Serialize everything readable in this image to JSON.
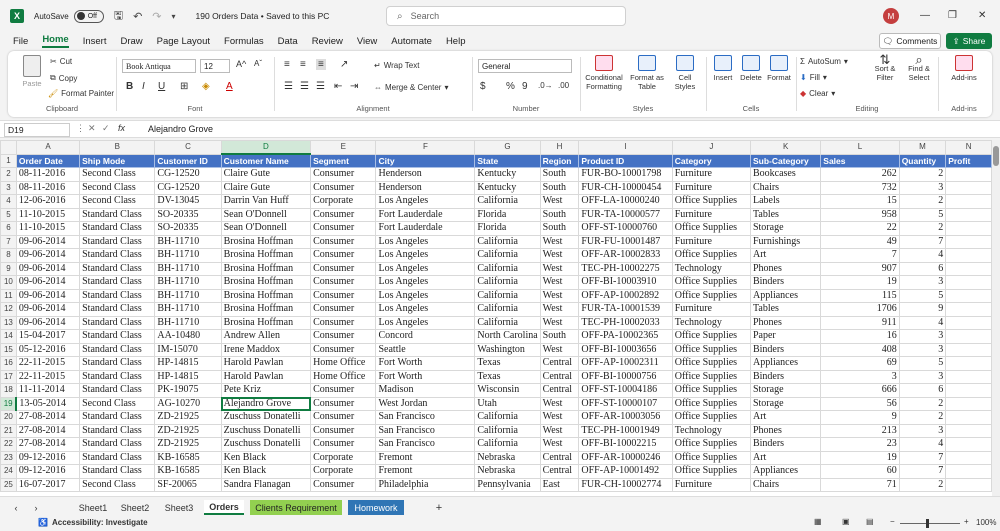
{
  "titlebar": {
    "app_icon": "X",
    "autosave_label": "AutoSave",
    "autosave_state": "Off",
    "doc_title": "190 Orders Data • Saved to this PC",
    "search_placeholder": "Search",
    "user_initial": "M"
  },
  "menu": {
    "items": [
      "File",
      "Home",
      "Insert",
      "Draw",
      "Page Layout",
      "Formulas",
      "Data",
      "Review",
      "View",
      "Automate",
      "Help"
    ],
    "active": "Home",
    "comments": "Comments",
    "share": "Share"
  },
  "ribbon": {
    "clipboard": {
      "title": "Clipboard",
      "paste": "Paste",
      "cut": "Cut",
      "copy": "Copy",
      "format_painter": "Format Painter"
    },
    "font": {
      "title": "Font",
      "name": "Book Antiqua",
      "size": "12",
      "bold": "B",
      "italic": "I",
      "underline": "U"
    },
    "alignment": {
      "title": "Alignment",
      "wrap": "Wrap Text",
      "merge": "Merge & Center"
    },
    "number": {
      "title": "Number",
      "format": "General",
      "currency": "$",
      "percent": "%",
      "comma": "9"
    },
    "styles": {
      "title": "Styles",
      "conditional": "Conditional Formatting",
      "format_table": "Format as Table",
      "cell_styles": "Cell Styles"
    },
    "cells": {
      "title": "Cells",
      "insert": "Insert",
      "delete": "Delete",
      "format": "Format"
    },
    "editing": {
      "title": "Editing",
      "autosum": "AutoSum",
      "fill": "Fill",
      "clear": "Clear",
      "sort": "Sort & Filter",
      "find": "Find & Select"
    },
    "addins": {
      "title": "Add-ins",
      "label": "Add-ins"
    }
  },
  "formula_bar": {
    "name_box": "D19",
    "fx": "fx",
    "value": "Alejandro Grove"
  },
  "sheet": {
    "columns": [
      "A",
      "B",
      "C",
      "D",
      "E",
      "F",
      "G",
      "H",
      "I",
      "J",
      "K",
      "L",
      "M",
      "N"
    ],
    "headers": [
      "Order Date",
      "Ship Mode",
      "Customer ID",
      "Customer Name",
      "Segment",
      "City",
      "State",
      "Region",
      "Product ID",
      "Category",
      "Sub-Category",
      "Sales",
      "Quantity",
      "Profit"
    ],
    "rows": [
      [
        "08-11-2016",
        "Second Class",
        "CG-12520",
        "Claire Gute",
        "Consumer",
        "Henderson",
        "Kentucky",
        "South",
        "FUR-BO-10001798",
        "Furniture",
        "Bookcases",
        "262",
        "2",
        ""
      ],
      [
        "08-11-2016",
        "Second Class",
        "CG-12520",
        "Claire Gute",
        "Consumer",
        "Henderson",
        "Kentucky",
        "South",
        "FUR-CH-10000454",
        "Furniture",
        "Chairs",
        "732",
        "3",
        ""
      ],
      [
        "12-06-2016",
        "Second Class",
        "DV-13045",
        "Darrin Van Huff",
        "Corporate",
        "Los Angeles",
        "California",
        "West",
        "OFF-LA-10000240",
        "Office Supplies",
        "Labels",
        "15",
        "2",
        ""
      ],
      [
        "11-10-2015",
        "Standard Class",
        "SO-20335",
        "Sean O'Donnell",
        "Consumer",
        "Fort Lauderdale",
        "Florida",
        "South",
        "FUR-TA-10000577",
        "Furniture",
        "Tables",
        "958",
        "5",
        ""
      ],
      [
        "11-10-2015",
        "Standard Class",
        "SO-20335",
        "Sean O'Donnell",
        "Consumer",
        "Fort Lauderdale",
        "Florida",
        "South",
        "OFF-ST-10000760",
        "Office Supplies",
        "Storage",
        "22",
        "2",
        ""
      ],
      [
        "09-06-2014",
        "Standard Class",
        "BH-11710",
        "Brosina Hoffman",
        "Consumer",
        "Los Angeles",
        "California",
        "West",
        "FUR-FU-10001487",
        "Furniture",
        "Furnishings",
        "49",
        "7",
        ""
      ],
      [
        "09-06-2014",
        "Standard Class",
        "BH-11710",
        "Brosina Hoffman",
        "Consumer",
        "Los Angeles",
        "California",
        "West",
        "OFF-AR-10002833",
        "Office Supplies",
        "Art",
        "7",
        "4",
        ""
      ],
      [
        "09-06-2014",
        "Standard Class",
        "BH-11710",
        "Brosina Hoffman",
        "Consumer",
        "Los Angeles",
        "California",
        "West",
        "TEC-PH-10002275",
        "Technology",
        "Phones",
        "907",
        "6",
        ""
      ],
      [
        "09-06-2014",
        "Standard Class",
        "BH-11710",
        "Brosina Hoffman",
        "Consumer",
        "Los Angeles",
        "California",
        "West",
        "OFF-BI-10003910",
        "Office Supplies",
        "Binders",
        "19",
        "3",
        ""
      ],
      [
        "09-06-2014",
        "Standard Class",
        "BH-11710",
        "Brosina Hoffman",
        "Consumer",
        "Los Angeles",
        "California",
        "West",
        "OFF-AP-10002892",
        "Office Supplies",
        "Appliances",
        "115",
        "5",
        ""
      ],
      [
        "09-06-2014",
        "Standard Class",
        "BH-11710",
        "Brosina Hoffman",
        "Consumer",
        "Los Angeles",
        "California",
        "West",
        "FUR-TA-10001539",
        "Furniture",
        "Tables",
        "1706",
        "9",
        ""
      ],
      [
        "09-06-2014",
        "Standard Class",
        "BH-11710",
        "Brosina Hoffman",
        "Consumer",
        "Los Angeles",
        "California",
        "West",
        "TEC-PH-10002033",
        "Technology",
        "Phones",
        "911",
        "4",
        ""
      ],
      [
        "15-04-2017",
        "Standard Class",
        "AA-10480",
        "Andrew Allen",
        "Consumer",
        "Concord",
        "North Carolina",
        "South",
        "OFF-PA-10002365",
        "Office Supplies",
        "Paper",
        "16",
        "3",
        ""
      ],
      [
        "05-12-2016",
        "Standard Class",
        "IM-15070",
        "Irene Maddox",
        "Consumer",
        "Seattle",
        "Washington",
        "West",
        "OFF-BI-10003656",
        "Office Supplies",
        "Binders",
        "408",
        "3",
        ""
      ],
      [
        "22-11-2015",
        "Standard Class",
        "HP-14815",
        "Harold Pawlan",
        "Home Office",
        "Fort Worth",
        "Texas",
        "Central",
        "OFF-AP-10002311",
        "Office Supplies",
        "Appliances",
        "69",
        "5",
        ""
      ],
      [
        "22-11-2015",
        "Standard Class",
        "HP-14815",
        "Harold Pawlan",
        "Home Office",
        "Fort Worth",
        "Texas",
        "Central",
        "OFF-BI-10000756",
        "Office Supplies",
        "Binders",
        "3",
        "3",
        ""
      ],
      [
        "11-11-2014",
        "Standard Class",
        "PK-19075",
        "Pete Kriz",
        "Consumer",
        "Madison",
        "Wisconsin",
        "Central",
        "OFF-ST-10004186",
        "Office Supplies",
        "Storage",
        "666",
        "6",
        ""
      ],
      [
        "13-05-2014",
        "Second Class",
        "AG-10270",
        "Alejandro Grove",
        "Consumer",
        "West Jordan",
        "Utah",
        "West",
        "OFF-ST-10000107",
        "Office Supplies",
        "Storage",
        "56",
        "2",
        ""
      ],
      [
        "27-08-2014",
        "Standard Class",
        "ZD-21925",
        "Zuschuss Donatelli",
        "Consumer",
        "San Francisco",
        "California",
        "West",
        "OFF-AR-10003056",
        "Office Supplies",
        "Art",
        "9",
        "2",
        ""
      ],
      [
        "27-08-2014",
        "Standard Class",
        "ZD-21925",
        "Zuschuss Donatelli",
        "Consumer",
        "San Francisco",
        "California",
        "West",
        "TEC-PH-10001949",
        "Technology",
        "Phones",
        "213",
        "3",
        ""
      ],
      [
        "27-08-2014",
        "Standard Class",
        "ZD-21925",
        "Zuschuss Donatelli",
        "Consumer",
        "San Francisco",
        "California",
        "West",
        "OFF-BI-10002215",
        "Office Supplies",
        "Binders",
        "23",
        "4",
        ""
      ],
      [
        "09-12-2016",
        "Standard Class",
        "KB-16585",
        "Ken Black",
        "Corporate",
        "Fremont",
        "Nebraska",
        "Central",
        "OFF-AR-10000246",
        "Office Supplies",
        "Art",
        "19",
        "7",
        ""
      ],
      [
        "09-12-2016",
        "Standard Class",
        "KB-16585",
        "Ken Black",
        "Corporate",
        "Fremont",
        "Nebraska",
        "Central",
        "OFF-AP-10001492",
        "Office Supplies",
        "Appliances",
        "60",
        "7",
        ""
      ],
      [
        "16-07-2017",
        "Second Class",
        "SF-20065",
        "Sandra Flanagan",
        "Consumer",
        "Philadelphia",
        "Pennsylvania",
        "East",
        "FUR-CH-10002774",
        "Furniture",
        "Chairs",
        "71",
        "2",
        ""
      ]
    ]
  },
  "tabs": [
    "Sheet1",
    "Sheet2",
    "Sheet3",
    "Orders",
    "Clients Requirement",
    "Homework"
  ],
  "active_tab": "Orders",
  "status": {
    "accessibility": "Accessibility: Investigate",
    "zoom": "100%"
  }
}
